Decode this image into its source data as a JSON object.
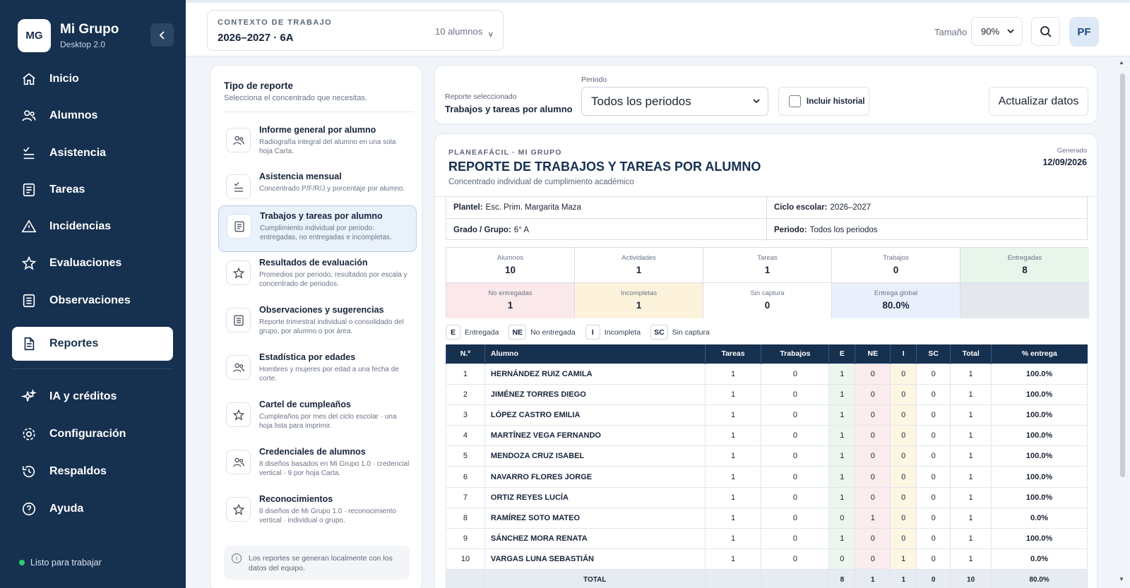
{
  "app": {
    "initials": "MG",
    "name": "Mi Grupo",
    "version": "Desktop 2.0",
    "status": "Listo para trabajar"
  },
  "sidebar": {
    "items": [
      {
        "label": "Inicio",
        "icon": "home-icon"
      },
      {
        "label": "Alumnos",
        "icon": "users-icon"
      },
      {
        "label": "Asistencia",
        "icon": "checklist-icon"
      },
      {
        "label": "Tareas",
        "icon": "document-icon"
      },
      {
        "label": "Incidencias",
        "icon": "warning-icon"
      },
      {
        "label": "Evaluaciones",
        "icon": "star-icon"
      },
      {
        "label": "Observaciones",
        "icon": "notes-icon"
      },
      {
        "label": "Reportes",
        "icon": "report-icon",
        "active": true
      },
      {
        "label": "IA y créditos",
        "icon": "sparkles-icon"
      },
      {
        "label": "Configuración",
        "icon": "gear-icon"
      },
      {
        "label": "Respaldos",
        "icon": "history-icon"
      },
      {
        "label": "Ayuda",
        "icon": "help-icon"
      }
    ]
  },
  "topbar": {
    "context_label": "CONTEXTO DE TRABAJO",
    "context_value": "2026–2027 · 6A",
    "student_count": "10 alumnos",
    "size_label": "Tamaño",
    "size_value": "90%",
    "user_initials": "PF"
  },
  "report_types": {
    "title": "Tipo de reporte",
    "subtitle": "Selecciona el concentrado que necesitas.",
    "items": [
      {
        "title": "Informe general por alumno",
        "desc": "Radiografía integral del alumno en una sola hoja Carta.",
        "icon": "users-icon"
      },
      {
        "title": "Asistencia mensual",
        "desc": "Concentrado P/F/R/J y porcentaje por alumno.",
        "icon": "checklist-icon"
      },
      {
        "title": "Trabajos y tareas por alumno",
        "desc": "Cumplimiento individual por periodo: entregadas, no entregadas e incompletas.",
        "icon": "document-icon",
        "active": true
      },
      {
        "title": "Resultados de evaluación",
        "desc": "Promedios por periodo, resultados por escala y concentrado de periodos.",
        "icon": "star-icon"
      },
      {
        "title": "Observaciones y sugerencias",
        "desc": "Reporte trimestral individual o consolidado del grupo, por alumno o por área.",
        "icon": "notes-icon"
      },
      {
        "title": "Estadística por edades",
        "desc": "Hombres y mujeres por edad a una fecha de corte.",
        "icon": "users-icon"
      },
      {
        "title": "Cartel de cumpleaños",
        "desc": "Cumpleaños por mes del ciclo escolar · una hoja lista para imprimir.",
        "icon": "star-icon"
      },
      {
        "title": "Credenciales de alumnos",
        "desc": "8 diseños basados en Mi Grupo 1.0 · credencial vertical · 9 por hoja Carta.",
        "icon": "users-icon"
      },
      {
        "title": "Reconocimientos",
        "desc": "8 diseños de Mi Grupo 1.0 · reconocimiento vertical · individual o grupo.",
        "icon": "star-icon"
      }
    ],
    "info": "Los reportes se generan localmente con los datos del equipo."
  },
  "controls": {
    "selected_label": "Reporte seleccionado",
    "selected_value": "Trabajos y tareas por alumno",
    "period_label": "Periodo",
    "period_value": "Todos los periodos",
    "history_label": "Incluir historial",
    "refresh_label": "Actualizar datos"
  },
  "report": {
    "brand": "PLANEAFÁCIL · MI GRUPO",
    "title": "REPORTE DE TRABAJOS Y TAREAS POR ALUMNO",
    "subtitle": "Concentrado individual de cumplimiento académico",
    "generated_label": "Generado",
    "generated_date": "12/09/2026",
    "meta": {
      "plantel_label": "Plantel:",
      "plantel": "Esc. Prim. Margarita Maza",
      "ciclo_label": "Ciclo escolar:",
      "ciclo": "2026–2027",
      "grado_label": "Grado / Grupo:",
      "grado": "6° A",
      "periodo_label": "Periodo:",
      "periodo": "Todos los periodos"
    },
    "stats": [
      {
        "label": "Alumnos",
        "value": "10",
        "bg": "#ffffff"
      },
      {
        "label": "Actividades",
        "value": "1",
        "bg": "#ffffff"
      },
      {
        "label": "Tareas",
        "value": "1",
        "bg": "#ffffff"
      },
      {
        "label": "Trabajos",
        "value": "0",
        "bg": "#ffffff"
      },
      {
        "label": "Entregadas",
        "value": "8",
        "bg": "#e8f5ea"
      },
      {
        "label": "No entregadas",
        "value": "1",
        "bg": "#fbe8ea"
      },
      {
        "label": "Incompletas",
        "value": "1",
        "bg": "#fdf3dc"
      },
      {
        "label": "Sin captura",
        "value": "0",
        "bg": "#ffffff"
      },
      {
        "label": "Entrega global",
        "value": "80.0%",
        "bg": "#e9f0fb"
      },
      {
        "label": "",
        "value": "",
        "bg": "#e4e8ed"
      }
    ],
    "legend": [
      {
        "code": "E",
        "label": "Entregada"
      },
      {
        "code": "NE",
        "label": "No entregada"
      },
      {
        "code": "I",
        "label": "Incompleta"
      },
      {
        "code": "SC",
        "label": "Sin captura"
      }
    ],
    "columns": [
      "N.º",
      "Alumno",
      "Tareas",
      "Trabajos",
      "E",
      "NE",
      "I",
      "SC",
      "Total",
      "% entrega"
    ],
    "rows": [
      [
        "1",
        "HERNÁNDEZ RUIZ CAMILA",
        "1",
        "0",
        "1",
        "0",
        "0",
        "0",
        "1",
        "100.0%"
      ],
      [
        "2",
        "JIMÉNEZ TORRES DIEGO",
        "1",
        "0",
        "1",
        "0",
        "0",
        "0",
        "1",
        "100.0%"
      ],
      [
        "3",
        "LÓPEZ CASTRO EMILIA",
        "1",
        "0",
        "1",
        "0",
        "0",
        "0",
        "1",
        "100.0%"
      ],
      [
        "4",
        "MARTÍNEZ VEGA FERNANDO",
        "1",
        "0",
        "1",
        "0",
        "0",
        "0",
        "1",
        "100.0%"
      ],
      [
        "5",
        "MENDOZA CRUZ ISABEL",
        "1",
        "0",
        "1",
        "0",
        "0",
        "0",
        "1",
        "100.0%"
      ],
      [
        "6",
        "NAVARRO FLORES JORGE",
        "1",
        "0",
        "1",
        "0",
        "0",
        "0",
        "1",
        "100.0%"
      ],
      [
        "7",
        "ORTIZ REYES LUCÍA",
        "1",
        "0",
        "1",
        "0",
        "0",
        "0",
        "1",
        "100.0%"
      ],
      [
        "8",
        "RAMÍREZ SOTO MATEO",
        "1",
        "0",
        "0",
        "1",
        "0",
        "0",
        "1",
        "0.0%"
      ],
      [
        "9",
        "SÁNCHEZ MORA RENATA",
        "1",
        "0",
        "1",
        "0",
        "0",
        "0",
        "1",
        "100.0%"
      ],
      [
        "10",
        "VARGAS LUNA SEBASTIÁN",
        "1",
        "0",
        "0",
        "0",
        "1",
        "0",
        "1",
        "0.0%"
      ]
    ],
    "total_row": [
      "",
      "TOTAL",
      "",
      "",
      "8",
      "1",
      "1",
      "0",
      "10",
      "80.0%"
    ]
  }
}
